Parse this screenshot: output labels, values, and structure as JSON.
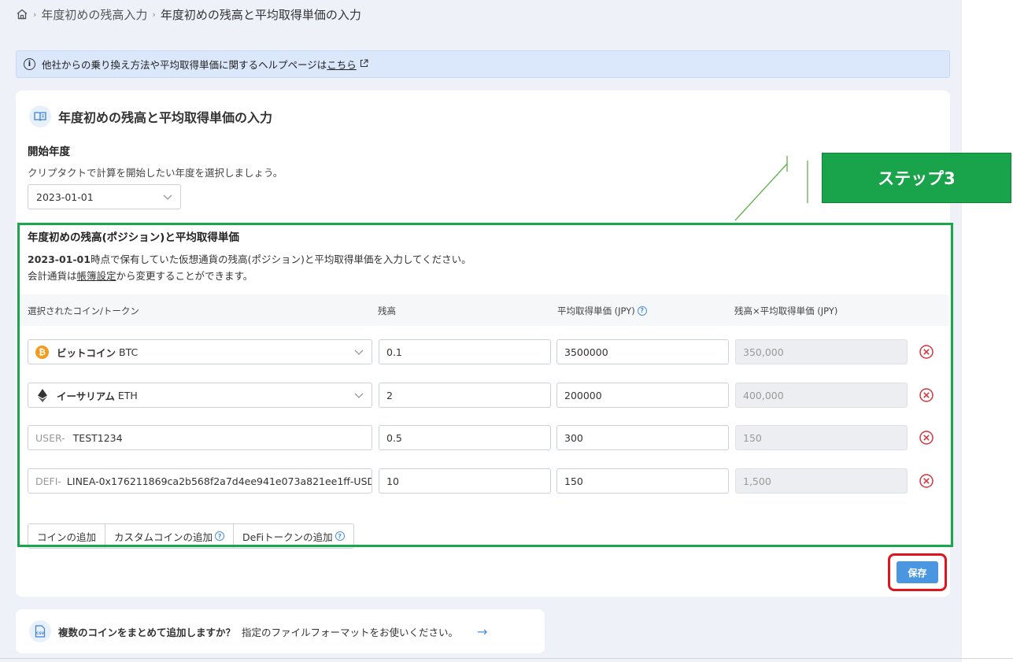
{
  "breadcrumb": {
    "item1": "年度初めの残高入力",
    "current": "年度初めの残高と平均取得単価の入力"
  },
  "help": {
    "text": "他社からの乗り換え方法や平均取得単価に関するヘルプページは",
    "link": "こちら"
  },
  "card": {
    "title": "年度初めの残高と平均取得単価の入力",
    "start_label": "開始年度",
    "start_desc": "クリプタクトで計算を開始したい年度を選択しましょう。",
    "start_date": "2023-01-01"
  },
  "section": {
    "title": "年度初めの残高(ポジション)と平均取得単価",
    "desc_date": "2023-01-01",
    "desc_rest": "時点で保有していた仮想通貨の残高(ポジション)と平均取得単価を入力してください。",
    "desc2_pre": "会計通貨は",
    "desc2_link": "帳簿設定",
    "desc2_post": "から変更することができます。"
  },
  "table": {
    "headers": {
      "coin": "選択されたコイン/トークン",
      "balance": "残高",
      "avg": "平均取得単価 (JPY)",
      "total": "残高×平均取得単価 (JPY)"
    },
    "rows": [
      {
        "name": "ビットコイン",
        "symbol": "BTC",
        "balance": "0.1",
        "avg": "3500000",
        "total": "350,000"
      },
      {
        "name": "イーサリアム",
        "symbol": "ETH",
        "balance": "2",
        "avg": "200000",
        "total": "400,000"
      },
      {
        "prefix": "USER-",
        "value": "TEST1234",
        "balance": "0.5",
        "avg": "300",
        "total": "150"
      },
      {
        "prefix": "DEFI-",
        "value": "LINEA-0x176211869ca2b568f2a7d4ee941e073a821ee1ff-USD",
        "balance": "10",
        "avg": "150",
        "total": "1,500"
      }
    ]
  },
  "buttons": {
    "add_coin": "コインの追加",
    "add_custom": "カスタムコインの追加",
    "add_defi": "DeFiトークンの追加",
    "save": "保存"
  },
  "annotation": {
    "step": "ステップ3"
  },
  "csv": {
    "bold": "複数のコインをまとめて追加しますか？",
    "text": "指定のファイルフォーマットをお使いください。",
    "arrow": "→"
  },
  "colors": {
    "accent": "#4b96e1",
    "step_green": "#19a34a",
    "highlight_red": "#e0141c",
    "btc": "#f39b1b"
  }
}
